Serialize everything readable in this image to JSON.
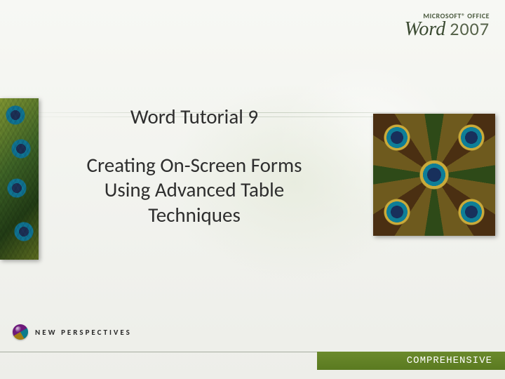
{
  "brand": {
    "line1": "MICROSOFT® OFFICE",
    "product": "Word",
    "year": "2007"
  },
  "title": {
    "kicker": "Word Tutorial 9",
    "main": "Creating On-Screen Forms Using Advanced Table Techniques"
  },
  "series": {
    "label": "NEW PERSPECTIVES"
  },
  "footer": {
    "level": "COMPREHENSIVE"
  }
}
